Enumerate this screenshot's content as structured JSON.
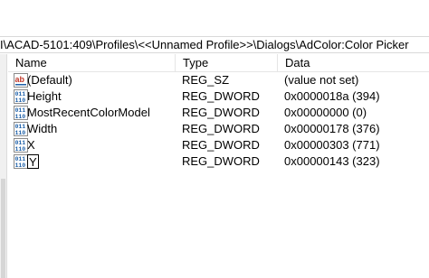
{
  "address": {
    "path": "I\\ACAD-5101:409\\Profiles\\<<Unnamed Profile>>\\Dialogs\\AdColor:Color Picker"
  },
  "columns": {
    "name": "Name",
    "type": "Type",
    "data": "Data"
  },
  "rows": [
    {
      "name": "(Default)",
      "type": "REG_SZ",
      "data": "(value not set)",
      "icon": "string-value-icon"
    },
    {
      "name": "Height",
      "type": "REG_DWORD",
      "data": "0x0000018a (394)",
      "icon": "binary-value-icon"
    },
    {
      "name": "MostRecentColorModel",
      "type": "REG_DWORD",
      "data": "0x00000000 (0)",
      "icon": "binary-value-icon"
    },
    {
      "name": "Width",
      "type": "REG_DWORD",
      "data": "0x00000178 (376)",
      "icon": "binary-value-icon"
    },
    {
      "name": "X",
      "type": "REG_DWORD",
      "data": "0x00000303 (771)",
      "icon": "binary-value-icon"
    },
    {
      "name": "Y",
      "type": "REG_DWORD",
      "data": "0x00000143 (323)",
      "icon": "binary-value-icon"
    }
  ],
  "colors": {
    "string_icon_red": "#c0392b",
    "binary_icon_blue": "#1c5fa8"
  }
}
